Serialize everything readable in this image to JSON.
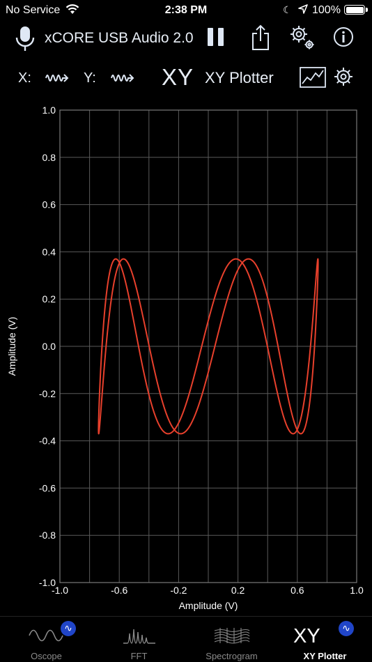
{
  "status_bar": {
    "carrier": "No Service",
    "time": "2:38 PM",
    "battery": "100%"
  },
  "header": {
    "device_name": "xCORE USB Audio 2.0",
    "x_label": "X:",
    "y_label": "Y:",
    "mode_symbol": "XY",
    "mode_name": "XY Plotter"
  },
  "icons": {
    "microphone": "microphone-icon",
    "pause": "pause-icon",
    "share": "share-icon",
    "settings": "gears-icon",
    "info": "info-icon",
    "x_signal": "signal-wave-icon",
    "y_signal": "signal-wave-icon",
    "plot_style": "line-plot-icon",
    "plot_settings": "gear-icon"
  },
  "colors": {
    "trace": "#e8402c",
    "grid": "#5a5a5a",
    "badge": "#2045c8"
  },
  "chart_data": {
    "type": "scatter",
    "xlabel": "Amplitude (V)",
    "ylabel": "Amplitude (V)",
    "xlim": [
      -1.0,
      1.0
    ],
    "ylim": [
      -1.0,
      1.0
    ],
    "x_ticks": [
      "-1.0",
      "-0.6",
      "-0.2",
      "0.2",
      "0.6",
      "1.0"
    ],
    "y_ticks": [
      "1.0",
      "0.8",
      "0.6",
      "0.4",
      "0.2",
      "0.0",
      "-0.2",
      "-0.4",
      "-0.6",
      "-0.8",
      "-1.0"
    ],
    "grid": true,
    "series": [
      {
        "x_amplitude": 0.74,
        "y_amplitude": 0.37,
        "x_frequency": 1,
        "y_frequency": 5,
        "phase": 0.3
      }
    ]
  },
  "tabs": [
    {
      "label": "Oscope",
      "icon": "oscope-wave-icon",
      "active": false
    },
    {
      "label": "FFT",
      "icon": "fft-spectrum-icon",
      "active": false
    },
    {
      "label": "Spectrogram",
      "icon": "spectrogram-icon",
      "active": false
    },
    {
      "label": "XY Plotter",
      "icon": "xy-icon",
      "symbol": "XY",
      "active": true
    }
  ],
  "badge_symbol": "∿"
}
